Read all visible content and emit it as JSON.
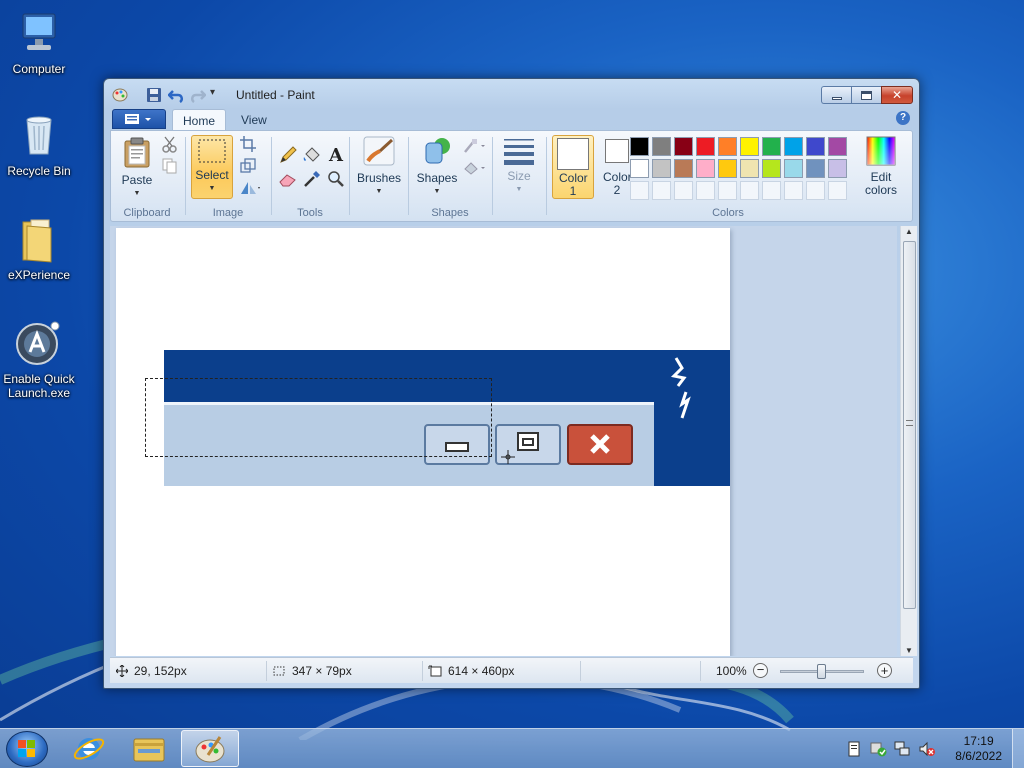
{
  "desktop": {
    "icons": [
      {
        "label": "Computer"
      },
      {
        "label": "Recycle Bin"
      },
      {
        "label": "eXPerience"
      },
      {
        "label": "Enable Quick Launch.exe"
      }
    ]
  },
  "window": {
    "title": "Untitled - Paint",
    "tabs": [
      {
        "label": "Home",
        "active": true
      },
      {
        "label": "View",
        "active": false
      }
    ],
    "help_glyph": "?",
    "close_glyph": "✕",
    "ribbon": {
      "clipboard": {
        "label": "Clipboard",
        "paste": "Paste"
      },
      "image": {
        "label": "Image",
        "select": "Select"
      },
      "tools": {
        "label": "Tools"
      },
      "brushes": {
        "label": "Brushes"
      },
      "shapes": {
        "label": "Shapes",
        "button": "Shapes"
      },
      "size": {
        "label": "Size"
      },
      "colors": {
        "label": "Colors",
        "color1": "Color 1",
        "color2": "Color 2",
        "edit": "Edit colors",
        "palette_row1": [
          "#000000",
          "#7f7f7f",
          "#880015",
          "#ed1c24",
          "#ff7f27",
          "#fff200",
          "#22b14c",
          "#00a2e8",
          "#3f48cc",
          "#a349a4"
        ],
        "palette_row2": [
          "#ffffff",
          "#c3c3c3",
          "#b97a57",
          "#ffaec9",
          "#ffc90e",
          "#efe4b0",
          "#b5e61d",
          "#99d9ea",
          "#7092be",
          "#c8bfe7"
        ]
      }
    },
    "status": {
      "cursor_pos": "29, 152px",
      "selection_size": "347 × 79px",
      "image_size": "614 × 460px",
      "zoom": "100%",
      "zoom_level_fraction": 0.5
    }
  },
  "taskbar": {
    "time": "17:19",
    "date": "8/6/2022"
  }
}
